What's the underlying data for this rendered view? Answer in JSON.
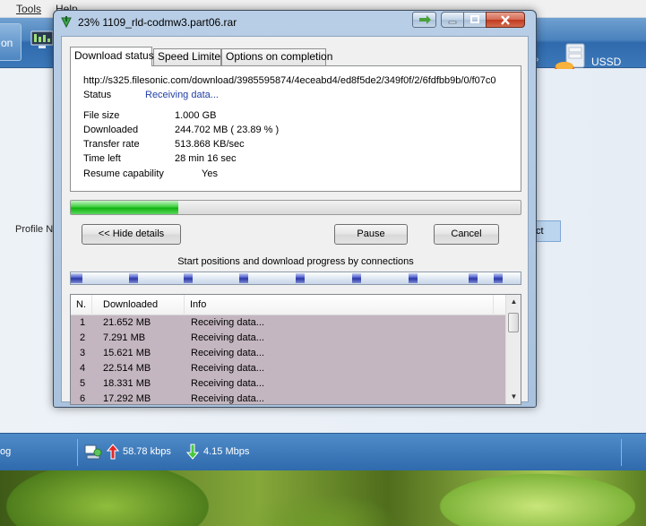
{
  "background_app": {
    "menu": [
      "Tools",
      "Help"
    ],
    "toolbar_left_label": "on",
    "ussd_label": "USSD",
    "profile_label": "Profile Na",
    "connect_label": "ct",
    "status_left": "og",
    "upload_speed": "58.78 kbps",
    "download_speed": "4.15 Mbps"
  },
  "dialog": {
    "title": "23% 1109_rld-codmw3.part06.rar",
    "tabs": [
      "Download status",
      "Speed Limiter",
      "Options on completion"
    ],
    "url": "http://s325.filesonic.com/download/3985595874/4eceabd4/ed8f5de2/349f0f/2/6fdfbb9b/0/f07c0",
    "status_label": "Status",
    "status_value": "Receiving data...",
    "details": [
      {
        "label": "File size",
        "value": "1.000  GB"
      },
      {
        "label": "Downloaded",
        "value": "244.702  MB  ( 23.89 % )"
      },
      {
        "label": "Transfer rate",
        "value": "513.868  KB/sec"
      },
      {
        "label": "Time left",
        "value": "28 min 16 sec"
      },
      {
        "label": "Resume capability",
        "value": "Yes"
      }
    ],
    "progress_fraction": 0.2389,
    "hide_details_label": "<< Hide details",
    "pause_label": "Pause",
    "cancel_label": "Cancel",
    "connections_caption": "Start positions and download progress by connections",
    "connection_segments": [
      0,
      0.13,
      0.25,
      0.375,
      0.5,
      0.625,
      0.75,
      0.885,
      0.94
    ],
    "list_headers": [
      "N.",
      "Downloaded",
      "Info"
    ],
    "rows": [
      {
        "n": "1",
        "downloaded": "21.652  MB",
        "info": "Receiving data..."
      },
      {
        "n": "2",
        "downloaded": "7.291  MB",
        "info": "Receiving data..."
      },
      {
        "n": "3",
        "downloaded": "15.621  MB",
        "info": "Receiving data..."
      },
      {
        "n": "4",
        "downloaded": "22.514  MB",
        "info": "Receiving data..."
      },
      {
        "n": "5",
        "downloaded": "18.331  MB",
        "info": "Receiving data..."
      },
      {
        "n": "6",
        "downloaded": "17.292  MB",
        "info": "Receiving data..."
      }
    ]
  },
  "colors": {
    "status_value": "#1f3fa6",
    "progress_green": "#12b312",
    "row_selected_bg": "#c4b6c0",
    "connection_blue": "#3a49c8"
  }
}
